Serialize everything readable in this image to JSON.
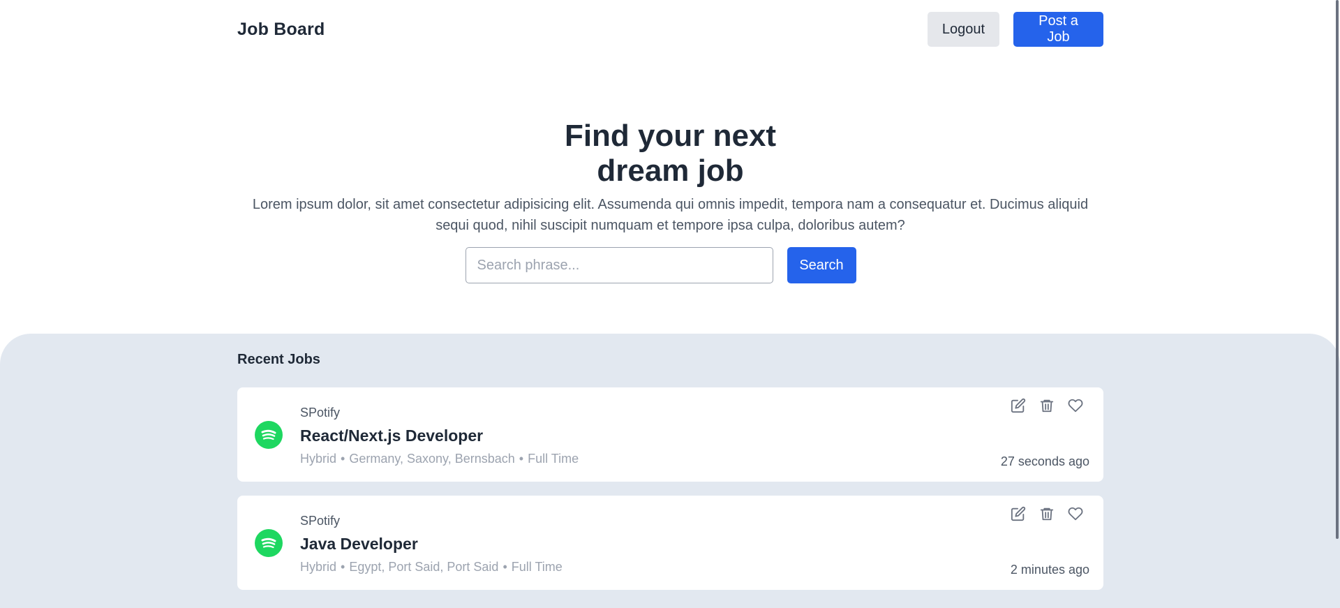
{
  "header": {
    "brand": "Job Board",
    "logout_label": "Logout",
    "post_job_label": "Post a Job"
  },
  "hero": {
    "title": "Find your next dream job",
    "description": "Lorem ipsum dolor, sit amet consectetur adipisicing elit. Assumenda qui omnis impedit, tempora nam a consequatur et. Ducimus aliquid sequi quod, nihil suscipit numquam et tempore ipsa culpa, doloribus autem?",
    "search_placeholder": "Search phrase...",
    "search_value": "",
    "search_button": "Search"
  },
  "jobs": {
    "section_title": "Recent Jobs",
    "items": [
      {
        "company": "SPotify",
        "title": "React/Next.js Developer",
        "work_mode": "Hybrid",
        "location": "Germany, Saxony, Bernsbach",
        "type": "Full Time",
        "posted": "27 seconds ago"
      },
      {
        "company": "SPotify",
        "title": "Java Developer",
        "work_mode": "Hybrid",
        "location": "Egypt, Port Said, Port Said",
        "type": "Full Time",
        "posted": "2 minutes ago"
      }
    ]
  },
  "icons": {
    "edit": "edit-icon",
    "delete": "trash-icon",
    "favorite": "heart-icon",
    "company_logo": "spotify-logo-icon"
  },
  "colors": {
    "primary": "#2563eb",
    "section_bg": "#e2e8f0",
    "spotify_green": "#1ed760"
  }
}
